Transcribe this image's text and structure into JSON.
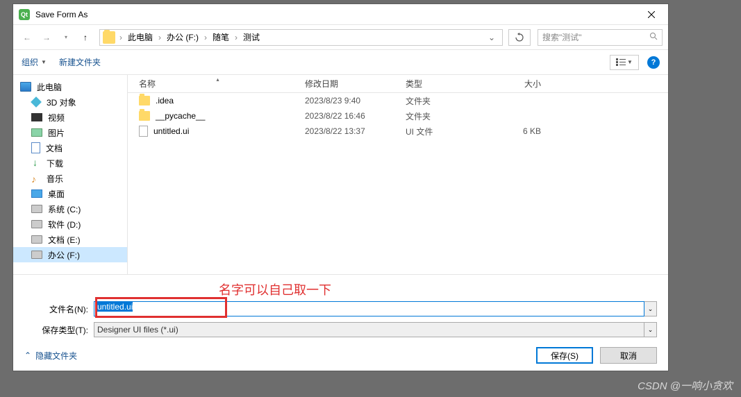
{
  "title": "Save Form As",
  "breadcrumb": [
    "此电脑",
    "办公 (F:)",
    "随笔",
    "测试"
  ],
  "search_placeholder": "搜索\"测试\"",
  "toolbar": {
    "organize": "组织",
    "new_folder": "新建文件夹"
  },
  "sidebar": [
    {
      "label": "此电脑",
      "icon": "monitor",
      "root": true
    },
    {
      "label": "3D 对象",
      "icon": "obj3d"
    },
    {
      "label": "视频",
      "icon": "vid"
    },
    {
      "label": "图片",
      "icon": "pic"
    },
    {
      "label": "文档",
      "icon": "doc"
    },
    {
      "label": "下载",
      "icon": "down"
    },
    {
      "label": "音乐",
      "icon": "music"
    },
    {
      "label": "桌面",
      "icon": "desk"
    },
    {
      "label": "系统 (C:)",
      "icon": "drive"
    },
    {
      "label": "软件 (D:)",
      "icon": "drive"
    },
    {
      "label": "文档 (E:)",
      "icon": "drive"
    },
    {
      "label": "办公 (F:)",
      "icon": "drive",
      "selected": true
    }
  ],
  "columns": {
    "name": "名称",
    "date": "修改日期",
    "type": "类型",
    "size": "大小"
  },
  "files": [
    {
      "name": ".idea",
      "date": "2023/8/23 9:40",
      "type": "文件夹",
      "size": "",
      "icon": "folder"
    },
    {
      "name": "__pycache__",
      "date": "2023/8/22 16:46",
      "type": "文件夹",
      "size": "",
      "icon": "folder"
    },
    {
      "name": "untitled.ui",
      "date": "2023/8/22 13:37",
      "type": "UI 文件",
      "size": "6 KB",
      "icon": "file"
    }
  ],
  "annotation": "名字可以自己取一下",
  "filename_label": "文件名(N):",
  "filename_value": "untitled.ui",
  "filetype_label": "保存类型(T):",
  "filetype_value": "Designer UI files (*.ui)",
  "hide_folders": "隐藏文件夹",
  "save_btn": "保存(S)",
  "cancel_btn": "取消",
  "watermark": "CSDN @一响小贪欢"
}
